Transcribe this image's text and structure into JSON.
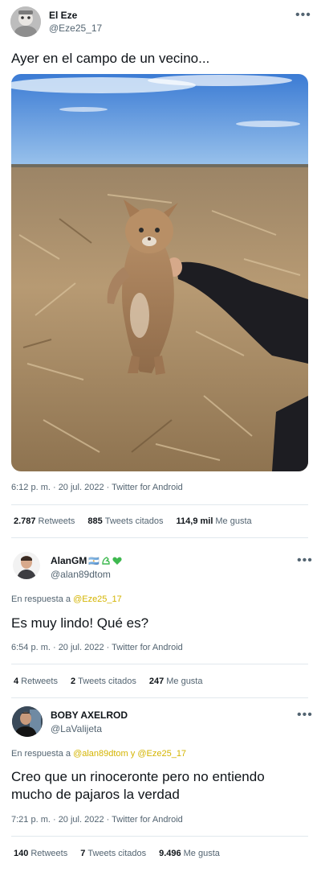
{
  "colors": {
    "text": "#0f1419",
    "secondary": "#536471",
    "link": "#d4b400",
    "divider": "#e1e8ed"
  },
  "tweet1": {
    "name": "El Eze",
    "handle": "@Eze25_17",
    "text": "Ayer en el campo de un vecino...",
    "meta": "6:12 p. m. · 20 jul. 2022 · Twitter for Android",
    "stats": {
      "retweets": "2.787",
      "retweets_label": "Retweets",
      "quotes": "885",
      "quotes_label": "Tweets citados",
      "likes": "114,9 mil",
      "likes_label": "Me gusta"
    }
  },
  "tweet2": {
    "name": "AlanGM",
    "name_emoji": "🇦🇷",
    "handle": "@alan89dtom",
    "reply_prefix": "En respuesta a",
    "reply_to": "@Eze25_17",
    "text": "Es muy lindo! Qué es?",
    "meta": "6:54 p. m. · 20 jul. 2022 · Twitter for Android",
    "stats": {
      "retweets": "4",
      "retweets_label": "Retweets",
      "quotes": "2",
      "quotes_label": "Tweets citados",
      "likes": "247",
      "likes_label": "Me gusta"
    }
  },
  "tweet3": {
    "name": "BOBY AXELROD",
    "handle": "@LaValijeta",
    "reply_prefix": "En respuesta a",
    "reply_to_1": "@alan89dtom",
    "reply_and": "y",
    "reply_to_2": "@Eze25_17",
    "text": "Creo que un rinoceronte pero no entiendo mucho de pajaros la verdad",
    "meta": "7:21 p. m. · 20 jul. 2022 · Twitter for Android",
    "stats": {
      "retweets": "140",
      "retweets_label": "Retweets",
      "quotes": "7",
      "quotes_label": "Tweets citados",
      "likes": "9.496",
      "likes_label": "Me gusta"
    }
  }
}
